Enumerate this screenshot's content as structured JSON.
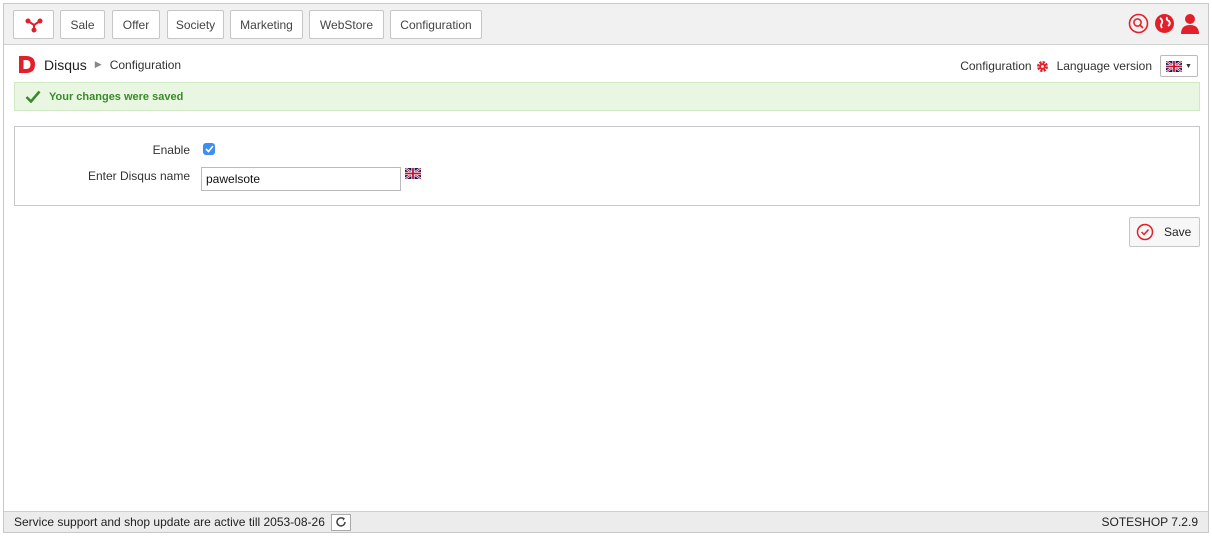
{
  "nav": {
    "logo_icon": "soteshop-logo-icon",
    "items": [
      {
        "label": "Sale"
      },
      {
        "label": "Offer"
      },
      {
        "label": "Society"
      },
      {
        "label": "Marketing"
      },
      {
        "label": "WebStore"
      },
      {
        "label": "Configuration"
      }
    ],
    "right_icons": [
      "search-icon",
      "globe-icon",
      "user-icon"
    ]
  },
  "header": {
    "title": "Disqus",
    "breadcrumb_current": "Configuration",
    "config_link": "Configuration",
    "language_label": "Language version",
    "language_flag": "uk-flag-icon"
  },
  "alert": {
    "message": "Your changes were saved",
    "color": "#3b8a2b"
  },
  "form": {
    "enable_label": "Enable",
    "enable_checked": true,
    "name_label": "Enter Disqus name",
    "name_value": "pawelsote"
  },
  "actions": {
    "save_label": "Save"
  },
  "footer": {
    "status_text": "Service support and shop update are active till 2053-08-26",
    "version": "SOTESHOP 7.2.9"
  },
  "colors": {
    "accent": "#e2202b",
    "success": "#3b8a2b",
    "checkbox": "#3d8ef0"
  }
}
